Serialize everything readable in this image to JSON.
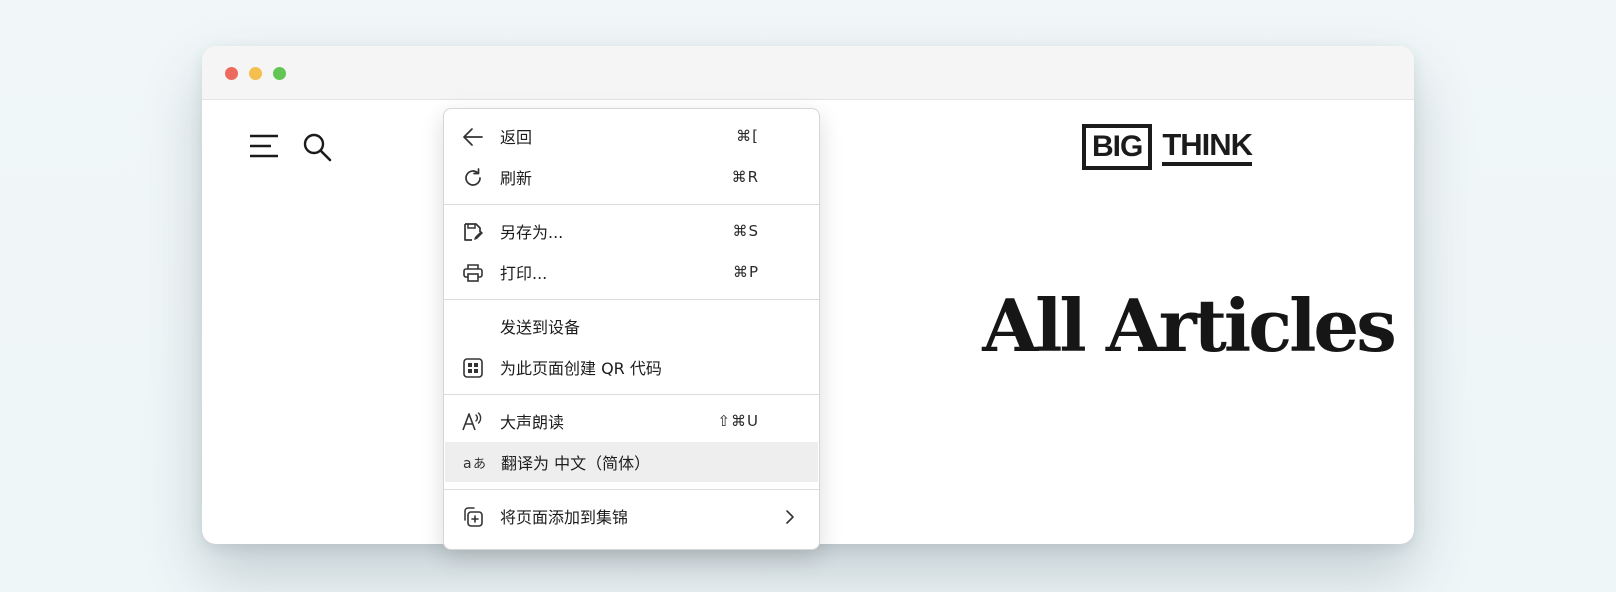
{
  "site": {
    "logo_left": "BIG",
    "logo_right": "THINK",
    "hero_title": "All Articles"
  },
  "icons": {
    "menu": "hamburger-menu-icon",
    "search": "search-icon"
  },
  "context_menu": {
    "items": [
      {
        "label": "返回",
        "shortcut": "⌘[",
        "icon": "back-arrow-icon"
      },
      {
        "label": "刷新",
        "shortcut": "⌘R",
        "icon": "refresh-icon"
      },
      {
        "label": "另存为...",
        "shortcut": "⌘S",
        "icon": "save-as-icon"
      },
      {
        "label": "打印...",
        "shortcut": "⌘P",
        "icon": "print-icon"
      },
      {
        "label": "发送到设备",
        "shortcut": "",
        "icon": ""
      },
      {
        "label": "为此页面创建 QR 代码",
        "shortcut": "",
        "icon": "qr-code-icon"
      },
      {
        "label": "大声朗读",
        "shortcut": "⇧⌘U",
        "icon": "read-aloud-icon"
      },
      {
        "label": "翻译为 中文（简体）",
        "shortcut": "",
        "icon": "translate-icon"
      },
      {
        "label": "将页面添加到集锦",
        "shortcut": "",
        "icon": "add-to-collections-icon"
      }
    ]
  },
  "colors": {
    "traffic_red": "#ec6a5e",
    "traffic_yellow": "#f4bf4f",
    "traffic_green": "#61c554",
    "menu_highlight": "#eeeeee"
  }
}
